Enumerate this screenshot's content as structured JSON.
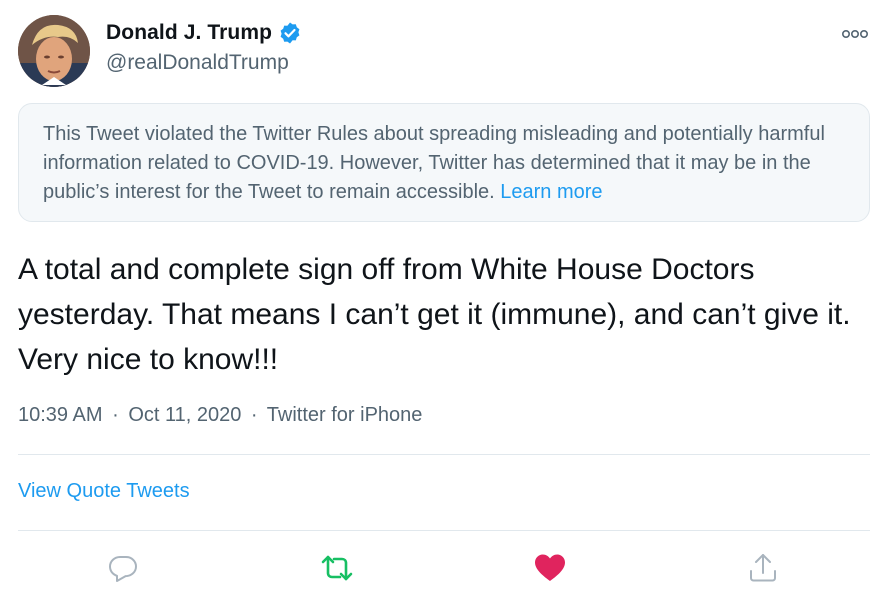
{
  "author": {
    "name": "Donald J. Trump",
    "handle": "@realDonaldTrump",
    "avatar_icon": "profile-photo",
    "verified_icon": "verified-badge-icon"
  },
  "notice": {
    "text": "This Tweet violated the Twitter Rules about spreading misleading and potentially harmful information related to COVID-19. However, Twitter has determined that it may be in the public’s interest for the Tweet to remain accessible.",
    "link_label": "Learn more"
  },
  "tweet": {
    "text": "A total and complete sign off from White House Doctors yesterday. That means I can’t get it (immune), and can’t give it. Very nice to know!!!",
    "time": "10:39 AM",
    "separator": "·",
    "date": "Oct 11, 2020",
    "source": "Twitter for iPhone"
  },
  "quote_tweets_label": "View Quote Tweets",
  "actions": [
    {
      "name": "reply",
      "icon": "reply-icon"
    },
    {
      "name": "retweet",
      "icon": "retweet-icon"
    },
    {
      "name": "like",
      "icon": "heart-icon"
    },
    {
      "name": "share",
      "icon": "share-icon"
    }
  ],
  "colors": {
    "accent": "#1d9bf0",
    "retweet": "#17bf63",
    "like": "#e0245e",
    "muted": "#536471",
    "notice_bg": "#f5f8fa"
  }
}
